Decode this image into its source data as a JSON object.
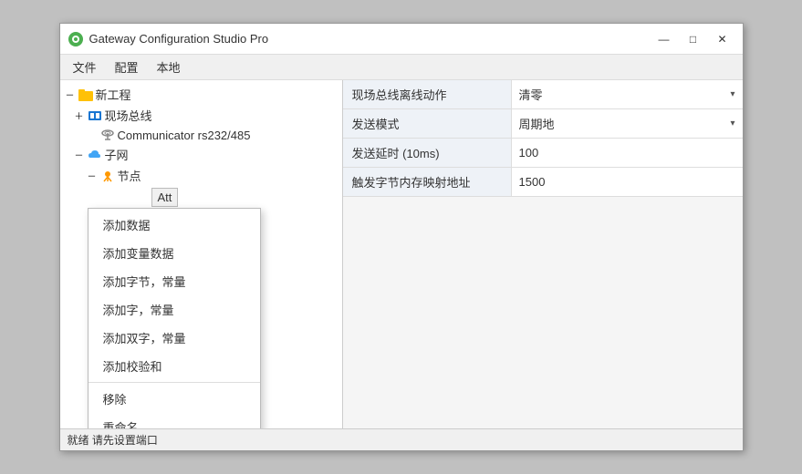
{
  "window": {
    "title": "Gateway Configuration Studio Pro",
    "icon_color": "#4caf50"
  },
  "titlebar": {
    "minimize_label": "—",
    "maximize_label": "□",
    "close_label": "✕"
  },
  "menu": {
    "items": [
      "文件",
      "配置",
      "本地"
    ]
  },
  "tree": {
    "root": {
      "toggle": "－",
      "icon": "folder",
      "label": "新工程"
    },
    "children": [
      {
        "indent": 1,
        "toggle": "＋",
        "icon": "bus",
        "label": "现场总线"
      },
      {
        "indent": 2,
        "toggle": "",
        "icon": "comm",
        "label": "Communicator rs232/485"
      },
      {
        "indent": 1,
        "toggle": "－",
        "icon": "cloud",
        "label": "子网"
      },
      {
        "indent": 2,
        "toggle": "－",
        "icon": "node",
        "label": "节点"
      }
    ]
  },
  "context_menu": {
    "items": [
      "添加数据",
      "添加变量数据",
      "添加字节，常量",
      "添加字，常量",
      "添加双字，常量",
      "添加校验和",
      "移除",
      "重命名"
    ]
  },
  "properties": [
    {
      "label": "现场总线离线动作",
      "value": "清零",
      "type": "dropdown"
    },
    {
      "label": "发送模式",
      "value": "周期地",
      "type": "dropdown"
    },
    {
      "label": "发送延时 (10ms)",
      "value": "100",
      "type": "text"
    },
    {
      "label": "触发字节内存映射地址",
      "value": "1500",
      "type": "text"
    }
  ],
  "status_bar": {
    "text": "就绪  请先设置端口"
  },
  "att_label": "Att"
}
